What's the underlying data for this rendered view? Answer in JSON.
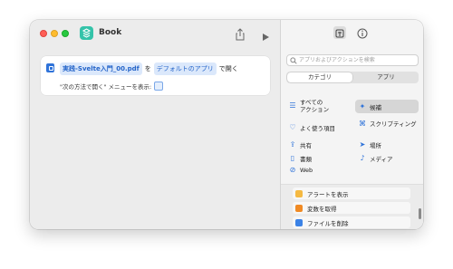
{
  "window": {
    "title": "Book"
  },
  "action": {
    "file_token": "実践-Svelte入門_00.pdf",
    "connector": "を",
    "app_token": "デフォルトのアプリ",
    "verb": "で開く",
    "option_text": "\"次の方法で開く\" メニューを表示:"
  },
  "panel": {
    "search_placeholder": "アプリおよびアクションを検索",
    "segments": [
      "カテゴリ",
      "アプリ"
    ],
    "active_segment": "カテゴリ",
    "categories_left": [
      {
        "label": "すべての\nアクション",
        "icon": "list-icon"
      },
      {
        "label": "よく使う項目",
        "icon": "heart-icon"
      },
      {
        "label": "共有",
        "icon": "share-icon"
      },
      {
        "label": "書類",
        "icon": "document-icon"
      },
      {
        "label": "Web",
        "icon": "compass-icon"
      }
    ],
    "categories_right": [
      {
        "label": "候補",
        "icon": "sparkle-icon",
        "selected": true
      },
      {
        "label": "スクリプティング",
        "icon": "scripting-icon"
      },
      {
        "label": "場所",
        "icon": "location-icon"
      },
      {
        "label": "メディア",
        "icon": "music-icon"
      }
    ],
    "actions": [
      {
        "label": "アラートを表示",
        "color": "#f5b942"
      },
      {
        "label": "変数を取得",
        "color": "#f08a24"
      },
      {
        "label": "ファイルを削除",
        "color": "#3b82e6"
      }
    ]
  }
}
